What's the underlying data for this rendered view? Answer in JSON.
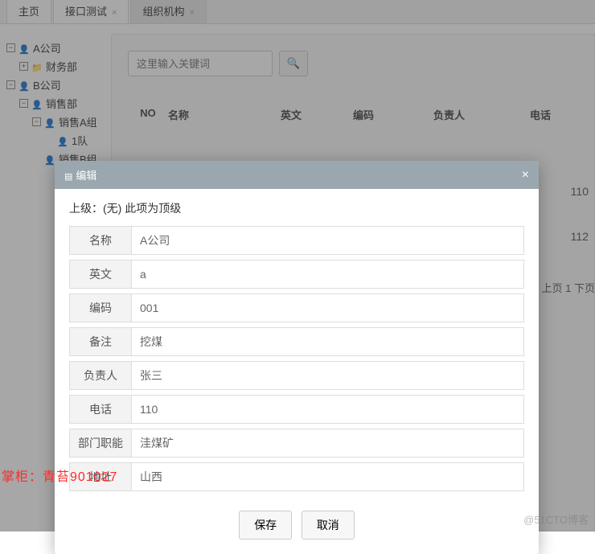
{
  "tabs": {
    "t0": "主页",
    "t1": "接口测试",
    "t2": "组织机构"
  },
  "tree": {
    "n0": "A公司",
    "n1": "财务部",
    "n2": "B公司",
    "n3": "销售部",
    "n4": "销售A组",
    "n5": "1队",
    "n6": "销售B组"
  },
  "search": {
    "placeholder": "这里输入关键词"
  },
  "columns": {
    "no": "NO",
    "name": "名称",
    "en": "英文",
    "code": "编码",
    "owner": "负责人",
    "phone": "电话"
  },
  "bg_rows": {
    "phone1": "110",
    "phone2": "112"
  },
  "pager": "上页  1 下页",
  "modal": {
    "title": "编辑",
    "parent_label": "上级：",
    "parent_value": "(无) 此项为顶级",
    "labels": {
      "name": "名称",
      "en": "英文",
      "code": "编码",
      "remark": "备注",
      "owner": "负责人",
      "phone": "电话",
      "duty": "部门职能",
      "addr": "地址"
    },
    "values": {
      "name": "A公司",
      "en": "a",
      "code": "001",
      "remark": "挖煤",
      "owner": "张三",
      "phone": "110",
      "duty": "洼煤矿",
      "addr": "山西"
    },
    "save": "保存",
    "cancel": "取消"
  },
  "watermark_red": "掌柜：青苔901027",
  "watermark_grey": "@51CTO博客"
}
